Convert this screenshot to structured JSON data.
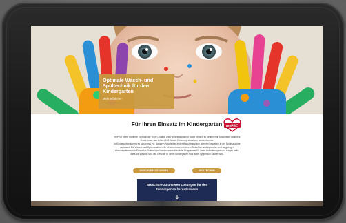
{
  "hero": {
    "title_line1": "Optimale Wasch- und",
    "title_line2": "Spültechnik für den",
    "title_line3": "Kindergarten",
    "link": "Mehr erfahren ›"
  },
  "section": {
    "heading": "Für Ihren Einsatz im Kindergarten",
    "logo_text": "myPRO",
    "paragraph": [
      "myPRO bietet moderne Technologie, hohe Qualität und Hygienestandards sowie einfach zu bedienende Maschinen dank des",
      "Know-hows, das in über 100 Jahren Erfahrung einsetzen werden konnte.",
      "In Kindergarten kommt es schon mal vor, dass ein Kuscheltier in der Waschmaschine oder ein Legostein in der Spülmaschine",
      "auftaucht. Die Wasch- und Spülmaschinen für Unternehmen mit einem Bedarf an anklungsvollen und langlebigen",
      "Waschsystemen von Electrolux Professional haben unterschiedliche Programme für diese Anforderungen und sorgen dafür,",
      "dass die Wäsche und das Geschirr in Ihrem Kindergarten trotz allem hygienisch sauber wird."
    ]
  },
  "buttons": {
    "wash": "WASCHVERSLÖSUNGEN",
    "dish": "SPÜLTECHNIK"
  },
  "cta": {
    "line1": "Broschüre zu unseren Lösungen für den",
    "line2": "Kindergarten herunterladen"
  },
  "icons": {
    "download": "download-icon"
  },
  "colors": {
    "accent": "#c99a40",
    "cta_bg": "#1d2b55",
    "logo_red": "#c8102e"
  }
}
